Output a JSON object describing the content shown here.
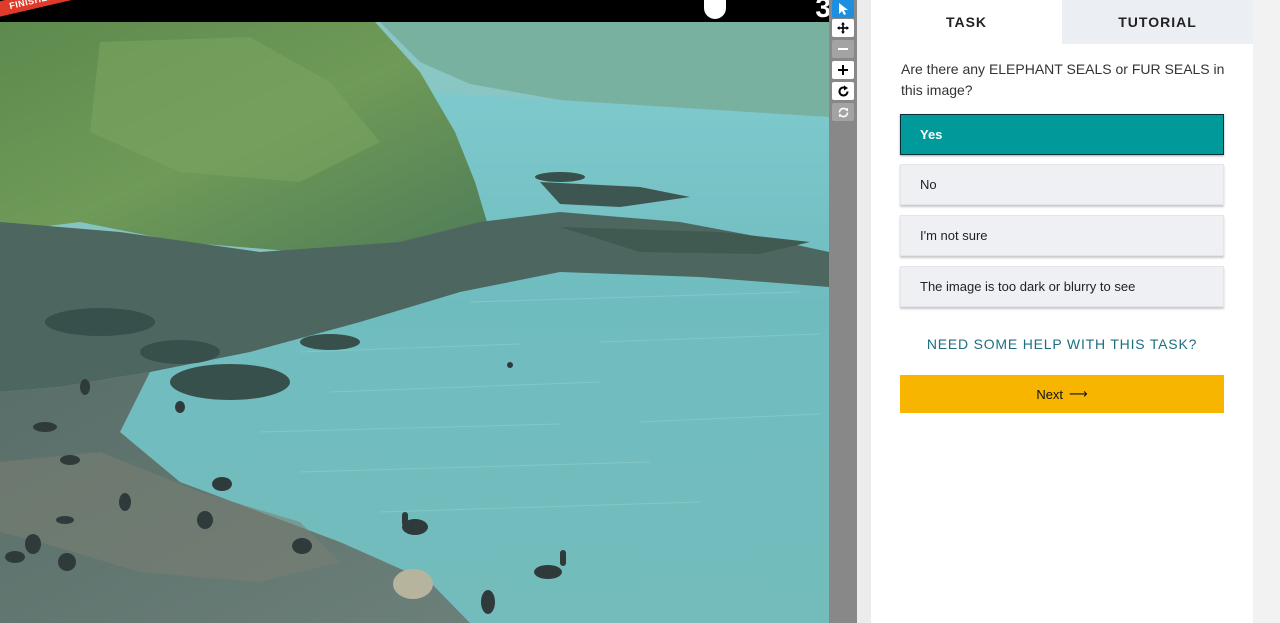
{
  "viewer": {
    "ribbon_label": "FINISHED",
    "frame_number": "3"
  },
  "tools": [
    {
      "name": "pointer-icon",
      "state": "active"
    },
    {
      "name": "pan-icon",
      "state": "normal"
    },
    {
      "name": "zoom-out-icon",
      "state": "disabled"
    },
    {
      "name": "zoom-in-icon",
      "state": "normal"
    },
    {
      "name": "rotate-icon",
      "state": "normal"
    },
    {
      "name": "reset-icon",
      "state": "disabled"
    }
  ],
  "tabs": {
    "task": "TASK",
    "tutorial": "TUTORIAL"
  },
  "task": {
    "question": "Are there any ELEPHANT SEALS or FUR SEALS in this image?",
    "answers": [
      {
        "label": "Yes",
        "selected": true
      },
      {
        "label": "No",
        "selected": false
      },
      {
        "label": "I'm not sure",
        "selected": false
      },
      {
        "label": "The image is too dark or blurry to see",
        "selected": false
      }
    ],
    "help": "NEED SOME HELP WITH THIS TASK?",
    "next": "Next",
    "next_arrow": "⟶"
  },
  "colors": {
    "selected_answer": "#009a9a",
    "next_button": "#f8b500",
    "active_tool": "#1d8fe1",
    "ribbon": "#e03b2a",
    "help_link": "#1d6f7f"
  }
}
